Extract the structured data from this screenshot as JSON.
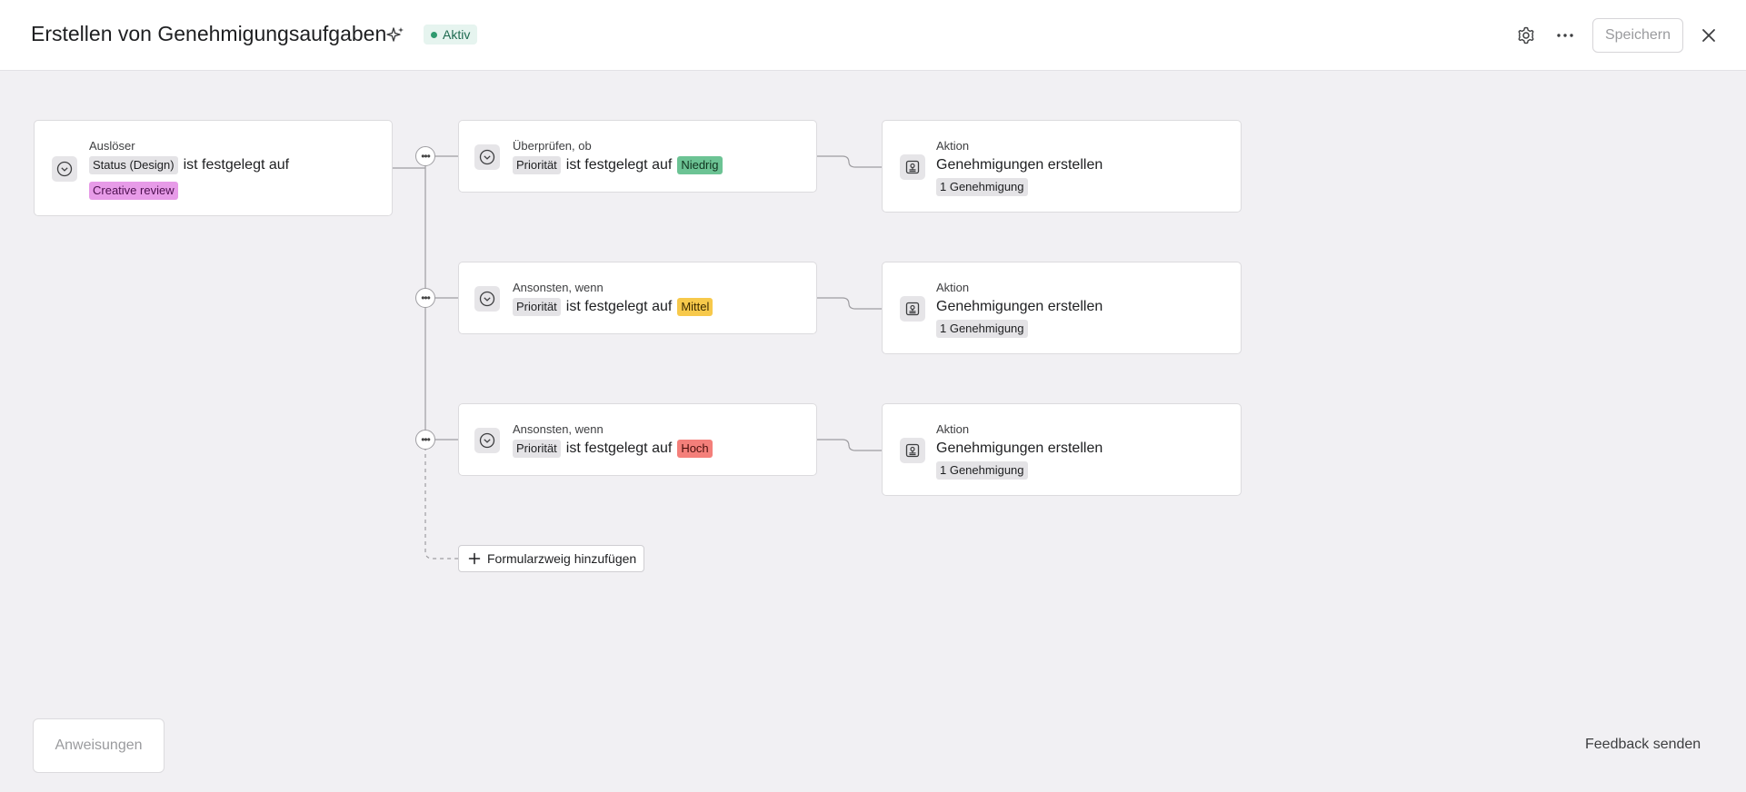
{
  "header": {
    "title": "Erstellen von Genehmigungsaufgaben",
    "status": "Aktiv",
    "save_label": "Speichern"
  },
  "trigger": {
    "label": "Auslöser",
    "field": "Status (Design)",
    "condition": "ist festgelegt auf",
    "value": "Creative review"
  },
  "branches": [
    {
      "label": "Überprüfen, ob",
      "field": "Priorität",
      "condition": "ist festgelegt auf",
      "value": "Niedrig",
      "action": {
        "label": "Aktion",
        "title": "Genehmigungen erstellen",
        "count": "1 Genehmigung"
      }
    },
    {
      "label": "Ansonsten, wenn",
      "field": "Priorität",
      "condition": "ist festgelegt auf",
      "value": "Mittel",
      "action": {
        "label": "Aktion",
        "title": "Genehmigungen erstellen",
        "count": "1 Genehmigung"
      }
    },
    {
      "label": "Ansonsten, wenn",
      "field": "Priorität",
      "condition": "ist festgelegt auf",
      "value": "Hoch",
      "action": {
        "label": "Aktion",
        "title": "Genehmigungen erstellen",
        "count": "1 Genehmigung"
      }
    }
  ],
  "add_branch_label": "Formularzweig hinzufügen",
  "footer": {
    "instructions_label": "Anweisungen",
    "feedback_label": "Feedback senden"
  },
  "icons": {
    "sparkle": "sparkle-icon",
    "settings": "gear-icon",
    "more": "more-horizontal-icon",
    "close": "close-icon",
    "trigger": "chevron-down-circle-icon",
    "condition": "chevron-down-circle-icon",
    "action": "stamp-icon",
    "add": "plus-icon"
  },
  "colors": {
    "status_active": "#2f9a6f",
    "low": "#6cc394",
    "medium": "#f7c94b",
    "high": "#f47f7a",
    "creative_review": "#e79be8"
  }
}
